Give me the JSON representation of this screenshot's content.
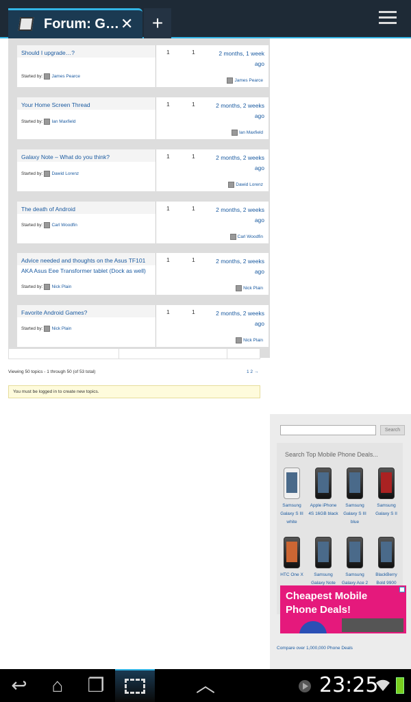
{
  "browser": {
    "tab_title": "Forum: G…",
    "close_glyph": "✕",
    "new_tab_glyph": "+",
    "favicon": "page-icon",
    "menu_icon": "overflow-menu-icon"
  },
  "topics": [
    {
      "title": "Should I upgrade…?",
      "started_label": "Started by:",
      "author": "James Pearce",
      "voices": "1",
      "posts": "1",
      "freshness": "2 months, 1 week ago",
      "last_poster": "James Pearce"
    },
    {
      "title": "Your Home Screen Thread",
      "started_label": "Started by:",
      "author": "Ian Maxfield",
      "voices": "1",
      "posts": "1",
      "freshness": "2 months, 2 weeks ago",
      "last_poster": "Ian Maxfield"
    },
    {
      "title": "Galaxy Note – What do you think?",
      "started_label": "Started by:",
      "author": "Dawid Lorenz",
      "voices": "1",
      "posts": "1",
      "freshness": "2 months, 2 weeks ago",
      "last_poster": "Dawid Lorenz"
    },
    {
      "title": "The death of Android",
      "started_label": "Started by:",
      "author": "Carl Woodfin",
      "voices": "1",
      "posts": "1",
      "freshness": "2 months, 2 weeks ago",
      "last_poster": "Carl Woodfin"
    },
    {
      "title": "Advice needed and thoughts on the Asus TF101 AKA Asus Eee Transformer tablet (Dock as well)",
      "started_label": "Started by:",
      "author": "Nick Plain",
      "voices": "1",
      "posts": "1",
      "freshness": "2 months, 2 weeks ago",
      "last_poster": "Nick Plain"
    },
    {
      "title": "Favorite Android Games?",
      "started_label": "Started by:",
      "author": "Nick Plain",
      "voices": "1",
      "posts": "1",
      "freshness": "2 months, 2 weeks ago",
      "last_poster": "Nick Plain"
    }
  ],
  "pagination": {
    "viewing": "Viewing 50 topics - 1 through 50 (of 53 total)",
    "pages": "1 2 →"
  },
  "notice": "You must be logged in to create new topics.",
  "sidebar": {
    "search_placeholder": "",
    "search_button": "Search",
    "deals_heading": "Search Top Mobile Phone Deals...",
    "phones": [
      {
        "name": "Samsung Galaxy S III white"
      },
      {
        "name": "Apple iPhone 4S 16GB black"
      },
      {
        "name": "Samsung Galaxy S III blue"
      },
      {
        "name": "Samsung Galaxy S II"
      },
      {
        "name": "HTC One X"
      },
      {
        "name": "Samsung Galaxy Note"
      },
      {
        "name": "Samsung Galaxy Ace 2"
      },
      {
        "name": "BlackBerry Bold 9900"
      }
    ],
    "compare_link": "Compare over 1,000,000 Phone Deals",
    "ad_text": "Cheapest Mobile Phone Deals!"
  },
  "system_bar": {
    "clock": "23:25",
    "back_glyph": "↩",
    "home_glyph": "⌂",
    "recents_glyph": "❐",
    "up_glyph": "︿",
    "colors": {
      "accent": "#33b5e5",
      "battery": "#7acd1f"
    }
  }
}
